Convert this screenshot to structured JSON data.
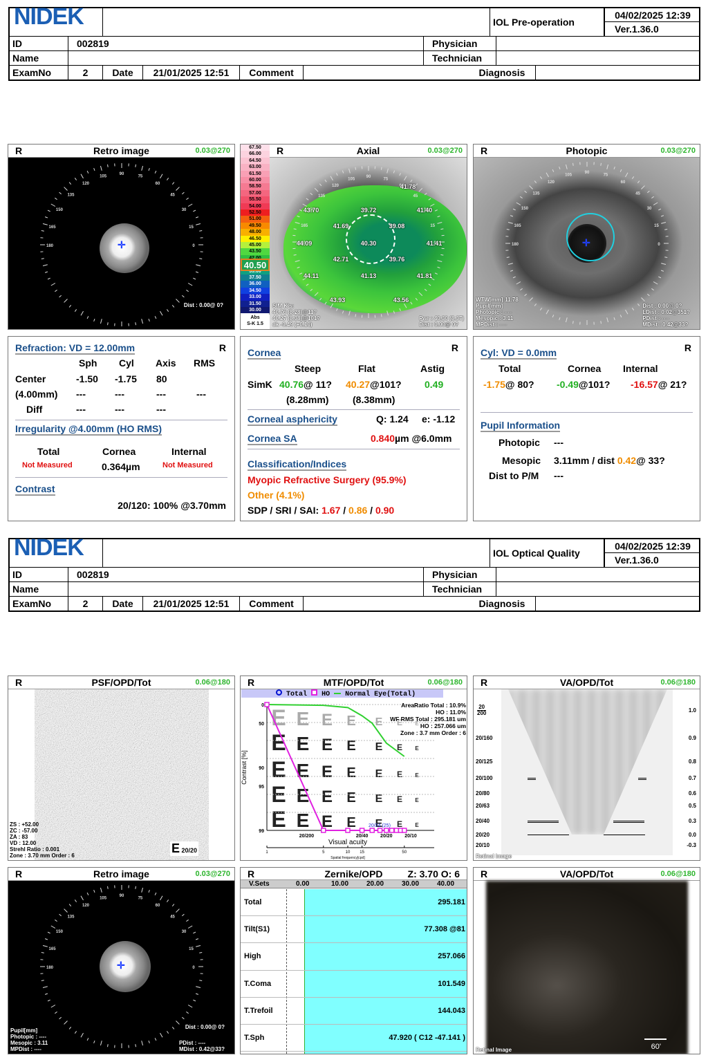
{
  "headers": [
    {
      "logo": "NIDEK",
      "title": "IOL Pre-operation",
      "datetime": "04/02/2025 12:39",
      "version": "Ver.1.36.0",
      "id_label": "ID",
      "id": "002819",
      "name_label": "Name",
      "physician_label": "Physician",
      "technician_label": "Technician",
      "examno_label": "ExamNo",
      "examno": "2",
      "date_label": "Date",
      "date": "21/01/2025 12:51",
      "comment_label": "Comment",
      "diagnosis_label": "Diagnosis"
    },
    {
      "logo": "NIDEK",
      "title": "IOL Optical Quality",
      "datetime": "04/02/2025 12:39",
      "version": "Ver.1.36.0",
      "id_label": "ID",
      "id": "002819",
      "name_label": "Name",
      "physician_label": "Physician",
      "technician_label": "Technician",
      "examno_label": "ExamNo",
      "examno": "2",
      "date_label": "Date",
      "date": "21/01/2025 12:51",
      "comment_label": "Comment",
      "diagnosis_label": "Diagnosis"
    }
  ],
  "eye": "R",
  "dial_labels": [
    "0",
    "15",
    "30",
    "45",
    "60",
    "75",
    "90",
    "105",
    "120",
    "135",
    "150",
    "165",
    "180"
  ],
  "retro": {
    "title": "Retro image",
    "value": "0.03@270",
    "dist": "Dist : 0.00@ 0?"
  },
  "axial": {
    "title": "Axial",
    "value": "0.03@270",
    "legend": [
      "67.50",
      "66.00",
      "64.50",
      "63.00",
      "61.50",
      "60.00",
      "58.50",
      "57.00",
      "55.50",
      "54.00",
      "52.50",
      "51.00",
      "49.50",
      "48.00",
      "46.50",
      "45.00",
      "43.50",
      "42.00",
      "40.50",
      "39.00",
      "37.50",
      "36.00",
      "34.50",
      "33.00",
      "31.50",
      "30.00"
    ],
    "legend_colors": [
      "#fde0ea",
      "#fcd3df",
      "#fbc3d2",
      "#f9b2c4",
      "#f8a0b5",
      "#f78ea5",
      "#f57a92",
      "#f4667f",
      "#f2506a",
      "#f03a55",
      "#ee1e20",
      "#f46010",
      "#f88a00",
      "#f8b000",
      "#fef000",
      "#b4f03c",
      "#50d840",
      "#30c040",
      "#20b060",
      "#10a080",
      "#108090",
      "#1060c0",
      "#1040e0",
      "#1020c0",
      "#102090",
      "#101870"
    ],
    "selected": "40.50",
    "legend_footer": "Abs",
    "legend_footer2": "S-K 1.5",
    "map_values": [
      "41.78",
      "43.70",
      "39.72",
      "41.40",
      "41.69",
      "39.08",
      "44.09",
      "40.30",
      "41.41",
      "42.71",
      "39.76",
      "44.11",
      "41.13",
      "41.81",
      "43.93",
      "43.56"
    ],
    "simk_title": "SIM K's:",
    "simk1": "40.76 (8.28)@11?",
    "simk2": "40.27 (8.38)@101?",
    "dk": "dk -0.49 (+0.10)",
    "pwr": "Pwr : 40.30 (8.37)",
    "dist": "Dist : 0.00@ 0?"
  },
  "photopic": {
    "title": "Photopic",
    "value": "0.03@270",
    "left": [
      "WTW[mm]:11.78",
      "Pupil[mm]",
      "Photopic : ----",
      "Mesopic : 3.11",
      "MPDist : ----"
    ],
    "right": [
      "Dist : 0.00@ 0?",
      "LDist : 0.02@351?",
      "PDist : ----",
      "MDist : 0.42@33?"
    ]
  },
  "refraction": {
    "title": "Refraction: VD = 12.00mm",
    "eye": "R",
    "cols": [
      "Sph",
      "Cyl",
      "Axis",
      "RMS"
    ],
    "rows": [
      {
        "label": "Center",
        "vals": [
          "-1.50",
          "-1.75",
          "80",
          ""
        ]
      },
      {
        "label": "(4.00mm)",
        "vals": [
          "---",
          "---",
          "---",
          "---"
        ]
      },
      {
        "label": "Diff",
        "vals": [
          "---",
          "---",
          "---",
          ""
        ]
      }
    ],
    "irr_title": "Irregularity @4.00mm (HO RMS)",
    "irr_cols": [
      "Total",
      "Cornea",
      "Internal"
    ],
    "irr_vals": [
      "Not Measured",
      "0.364µm",
      "Not Measured"
    ],
    "contrast_title": "Contrast",
    "contrast": "20/120: 100%  @3.70mm"
  },
  "cornea": {
    "title": "Cornea",
    "eye": "R",
    "cols": [
      "Steep",
      "Flat",
      "Astig"
    ],
    "simk_label": "SimK",
    "steep": "40.76",
    "steep_axis": "@ 11?",
    "flat": "40.27",
    "flat_axis": "@101?",
    "astig": "0.49",
    "steep_mm": "(8.28mm)",
    "flat_mm": "(8.38mm)",
    "asph_title": "Corneal asphericity",
    "q": "Q: 1.24",
    "e": "e: -1.12",
    "sa_title": "Cornea SA",
    "sa": "0.840",
    "sa_unit": "µm @6.0mm",
    "class_title": "Classification/Indices",
    "class1": "Myopic Refractive Surgery (95.9%)",
    "class2": "Other (4.1%)",
    "sdp_label": "SDP / SRI / SAI: ",
    "sdp": "1.67",
    "sri": "0.86",
    "sai": "0.90",
    "sep": " / "
  },
  "cyl": {
    "title": "Cyl: VD = 0.0mm",
    "eye": "R",
    "cols": [
      "Total",
      "Cornea",
      "Internal"
    ],
    "vals": [
      {
        "v": "-1.75",
        "a": "@ 80?"
      },
      {
        "v": "-0.49",
        "a": "@101?"
      },
      {
        "v": "-16.57",
        "a": "@ 21?"
      }
    ],
    "pupil_title": "Pupil Information",
    "photopic_label": "Photopic",
    "photopic": "---",
    "mesopic_label": "Mesopic",
    "mesopic": "3.11mm / dist ",
    "mesopic_dist": "0.42",
    "mesopic_axis": "@ 33?",
    "pm_label": "Dist to P/M",
    "pm": "---"
  },
  "psf": {
    "title": "PSF/OPD/Tot",
    "value": "0.06@180",
    "info": [
      "ZS : +52.00",
      "ZC : -57.00",
      "ZA : 83",
      "VD : 12.00",
      "Strehl Ratio : 0.001",
      "Zone : 3.70 mm Order : 6"
    ],
    "e_label": "20/20"
  },
  "mtf": {
    "title": "MTF/OPD/Tot",
    "value": "0.06@180",
    "legend_total": "Total",
    "legend_ho": "HO",
    "legend_normal": "Normal Eye(Total)",
    "stats": [
      "AreaRatio Total : 10.9%",
      "HO : 11.0%",
      "WF RMS Total : 295.181 um",
      "HO : 257.066 um",
      "Zone : 3.7 mm Order : 6"
    ],
    "ylabel": "Contrast [%]",
    "xlabel": "Visual acuity",
    "x2label": "Spatial frequency[cpd]",
    "yticks": [
      "0",
      "50",
      "90",
      "95",
      "99"
    ],
    "xticks": [
      "20/200",
      "20/40",
      "20/20",
      "20/10"
    ],
    "x2ticks": [
      "1",
      "5",
      "10",
      "15",
      "50"
    ],
    "marker_label": "20/24 (25)",
    "normal_eye": [
      [
        1,
        0
      ],
      [
        5,
        2
      ],
      [
        10,
        8
      ],
      [
        15,
        30
      ],
      [
        20,
        50
      ],
      [
        30,
        68
      ],
      [
        50,
        80
      ]
    ],
    "ho": [
      [
        1,
        0
      ],
      [
        5,
        99
      ],
      [
        10,
        99
      ],
      [
        15,
        99
      ],
      [
        20,
        99
      ],
      [
        25,
        99
      ],
      [
        30,
        99
      ],
      [
        35,
        99
      ],
      [
        40,
        99
      ],
      [
        45,
        99
      ],
      [
        50,
        99
      ]
    ]
  },
  "va": {
    "title": "VA/OPD/Tot",
    "value": "0.06@180",
    "left": [
      "20/160",
      "20/125",
      "20/100",
      "20/80",
      "20/63",
      "20/40",
      "20/20",
      "20/10"
    ],
    "top_num": "20",
    "top_den": "200",
    "right": [
      "1.0",
      "0.9",
      "0.8",
      "0.7",
      "0.6",
      "0.5",
      "0.3",
      "0.0",
      "-0.3"
    ],
    "footer": "Retinal Image"
  },
  "retro2": {
    "title": "Retro image",
    "value": "0.03@270",
    "left": [
      "Pupil[mm]",
      "Photopic : ----",
      "Mesopic : 3.11",
      "MPDist : ----"
    ],
    "dist": "Dist : 0.00@ 0?",
    "right": [
      "PDist : ----",
      "MDist : 0.42@33?"
    ]
  },
  "zernike": {
    "title": "Zernike/OPD",
    "zo": "Z: 3.70 O: 6",
    "col0": "V.Sets",
    "axis": [
      "0.00",
      "10.00",
      "20.00",
      "30.00",
      "40.00"
    ],
    "rows": [
      {
        "label": "Total",
        "value": "295.181"
      },
      {
        "label": "Tilt(S1)",
        "value": "77.308 @81"
      },
      {
        "label": "High",
        "value": "257.066"
      },
      {
        "label": "T.Coma",
        "value": "101.549"
      },
      {
        "label": "T.Trefoil",
        "value": "144.043"
      },
      {
        "label": "T.Sph",
        "value": "47.920 ( C12 -47.141 )"
      }
    ]
  },
  "va2": {
    "title": "VA/OPD/Tot",
    "value": "0.06@180",
    "footer": "Retinal Image",
    "scale": "60'"
  }
}
